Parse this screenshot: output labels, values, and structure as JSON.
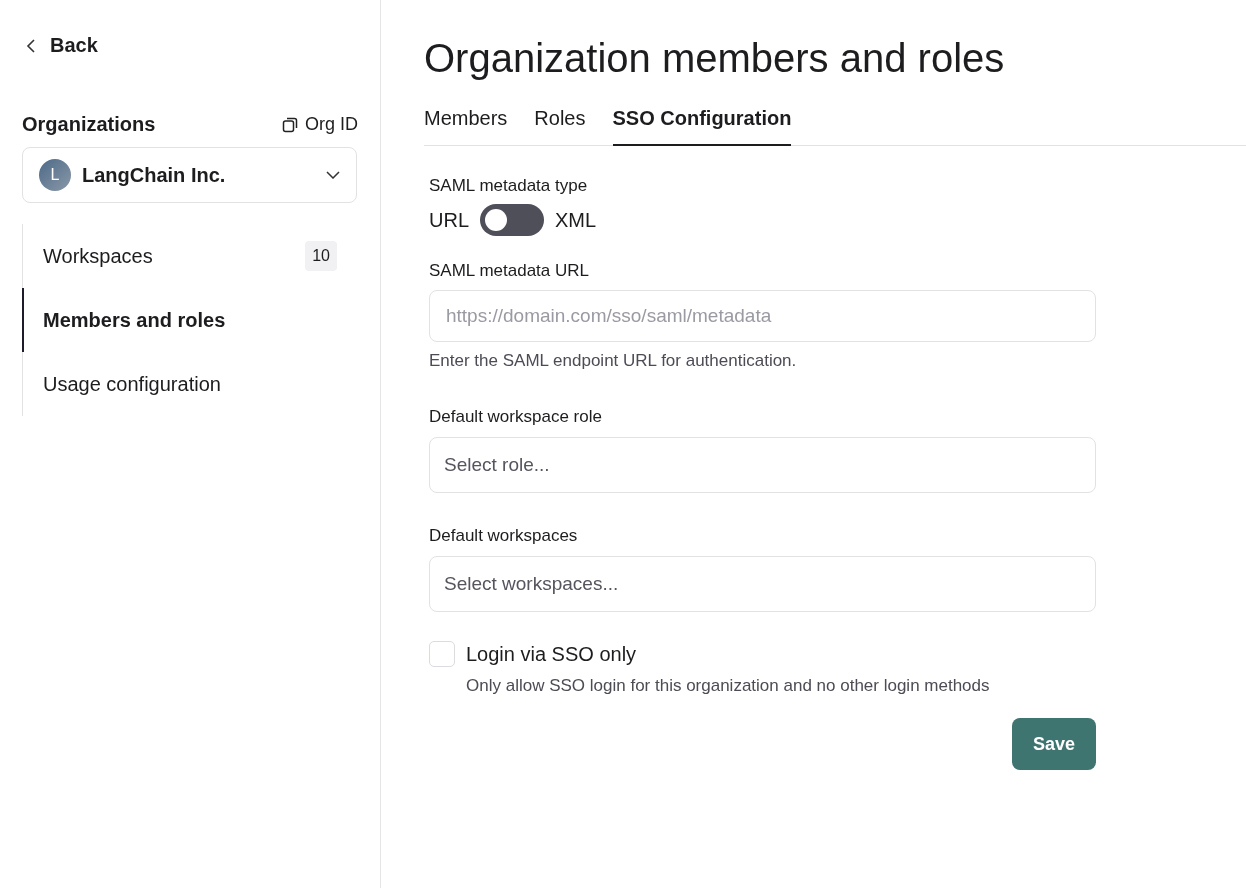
{
  "sidebar": {
    "back": "Back",
    "section_title": "Organizations",
    "org_id_button": "Org ID",
    "org_select": {
      "avatar": "L",
      "value": "LangChain Inc."
    },
    "items": [
      {
        "label": "Workspaces",
        "badge": "10",
        "selected": false
      },
      {
        "label": "Members and roles",
        "selected": true
      },
      {
        "label": "Usage configuration",
        "selected": false
      }
    ]
  },
  "title": "Organization members and roles",
  "tabs": [
    {
      "label": "Members",
      "selected": false
    },
    {
      "label": "Roles",
      "selected": false
    },
    {
      "label": "SSO Configuration",
      "selected": true
    }
  ],
  "form": {
    "metadata_type": {
      "label": "SAML metadata type",
      "off_label": "URL",
      "on_label": "XML",
      "on": false
    },
    "metadata_url": {
      "label": "SAML metadata URL",
      "placeholder": "https://domain.com/sso/saml/metadata",
      "helper": "Enter the SAML endpoint URL for authentication."
    },
    "role": {
      "label": "Default workspace role",
      "placeholder": "Select role..."
    },
    "workspaces": {
      "label": "Default workspaces",
      "placeholder": "Select workspaces..."
    },
    "sso_only": {
      "label": "Login via SSO only",
      "description": "Only allow SSO login for this organization and no other login methods",
      "checked": false
    },
    "save": "Save"
  }
}
